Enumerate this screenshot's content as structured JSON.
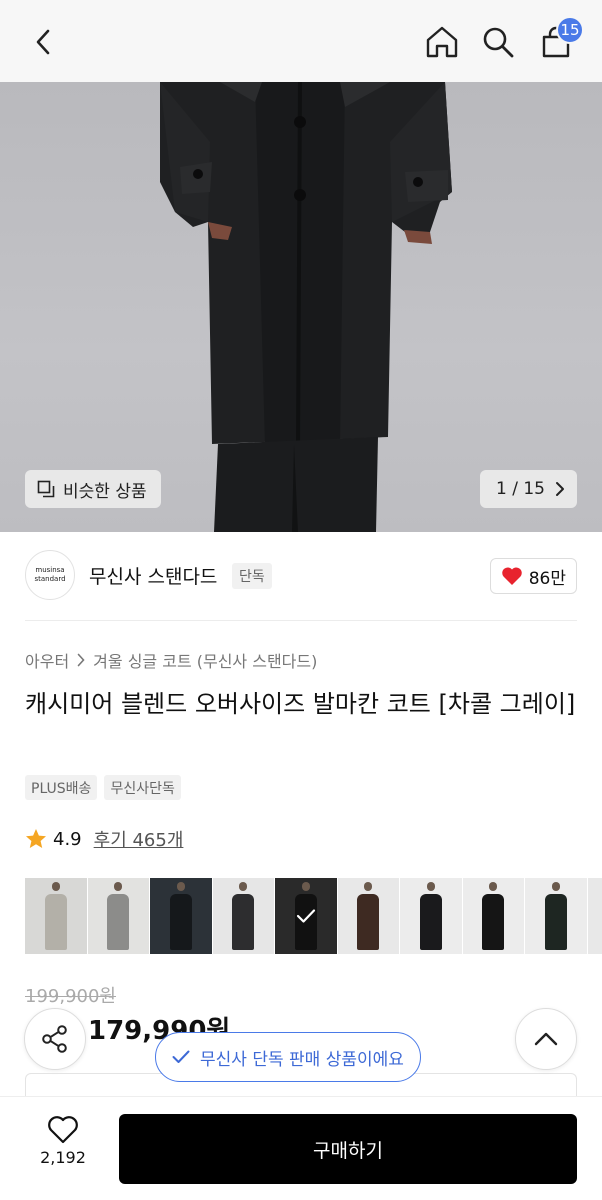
{
  "header": {
    "cart_count": "15",
    "icons": [
      "back-icon",
      "home-icon",
      "search-icon",
      "cart-icon"
    ]
  },
  "hero": {
    "similar_label": "비슷한 상품",
    "counter": "1 / 15"
  },
  "brand": {
    "logo_line1": "musinsa",
    "logo_line2": "standard",
    "name": "무신사 스탠다드",
    "tag": "단독",
    "likes": "86만"
  },
  "product": {
    "breadcrumb_category": "아우터",
    "breadcrumb_sub": "겨울 싱글 코트 (무신사 스탠다드)",
    "title": "캐시미어 블렌드 오버사이즈 발마칸 코트 [차콜 그레이]",
    "tags": [
      "PLUS배송",
      "무신사단독"
    ],
    "rating": "4.9",
    "review_label": "후기 465개"
  },
  "thumbnails": [
    {
      "bg": "#d8d8d6",
      "coat": "#b3b0a8"
    },
    {
      "bg": "#e2e2e0",
      "coat": "#8c8c8a"
    },
    {
      "bg": "#2c3238",
      "coat": "#15181b"
    },
    {
      "bg": "#e6e6e6",
      "coat": "#2d2d2f"
    },
    {
      "bg": "#2a2a2a",
      "coat": "#111111",
      "selected": true
    },
    {
      "bg": "#e8e8e8",
      "coat": "#3e2a22"
    },
    {
      "bg": "#ececec",
      "coat": "#1a1a1c"
    },
    {
      "bg": "#ececec",
      "coat": "#151515"
    },
    {
      "bg": "#ececec",
      "coat": "#1e2622"
    },
    {
      "bg": "#e8e8e8",
      "coat": "#4a4438"
    }
  ],
  "price": {
    "original": "199,900원",
    "sale": "179,990원"
  },
  "toast": {
    "text": "무신사 단독 판매 상품이에요"
  },
  "bottom": {
    "wish_count": "2,192",
    "buy_label": "구매하기"
  },
  "colors": {
    "accent": "#4a7ae8",
    "heart": "#e8232e",
    "star": "#f5a623",
    "buy_button": "#000000"
  }
}
